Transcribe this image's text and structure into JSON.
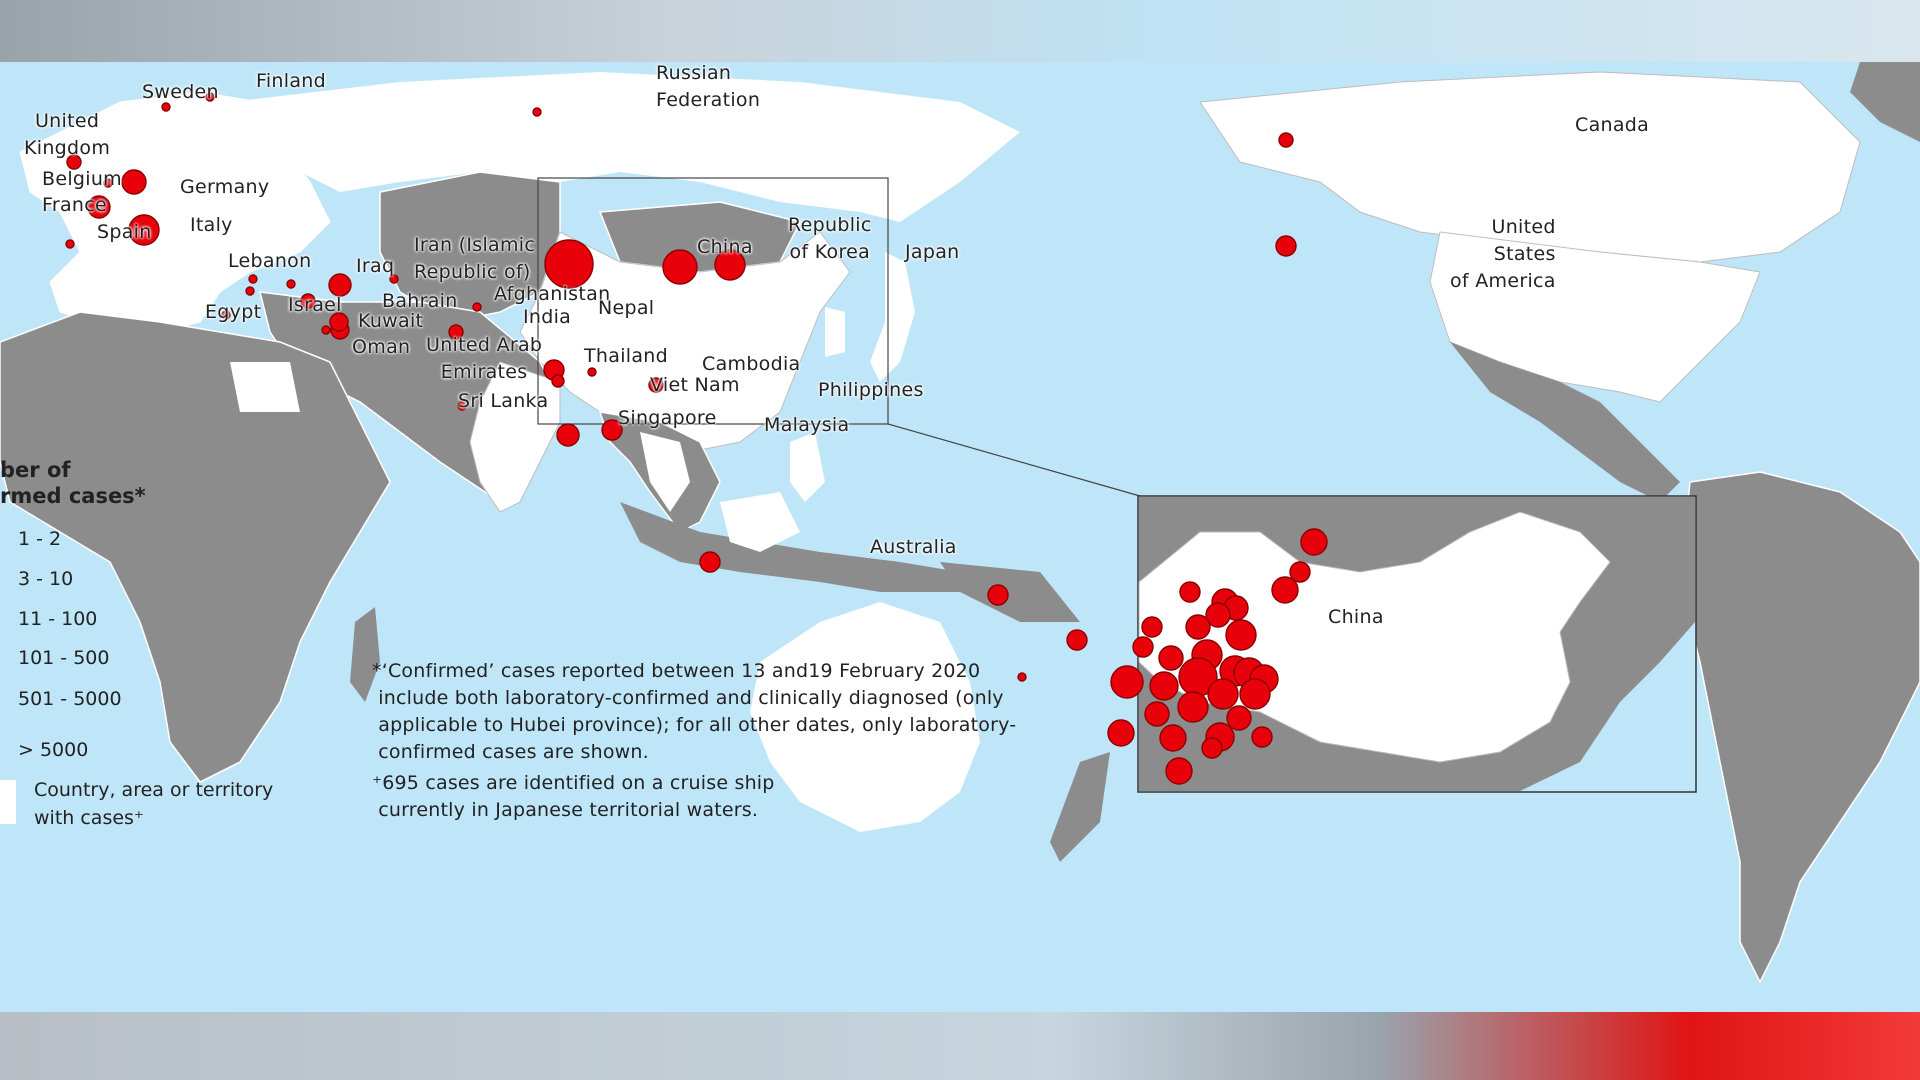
{
  "colors": {
    "ocean": "#bfe6f8",
    "land_no_cases": "#8c8c8c",
    "land_with_cases": "#ffffff",
    "case_marker": "#e8000b"
  },
  "countries": [
    {
      "id": "sweden",
      "label": "Sweden"
    },
    {
      "id": "finland",
      "label": "Finland"
    },
    {
      "id": "russia",
      "label": "Russian\nFederation"
    },
    {
      "id": "uk",
      "label": "United\nKingdom"
    },
    {
      "id": "belgium",
      "label": "Belgium"
    },
    {
      "id": "germany",
      "label": "Germany"
    },
    {
      "id": "france",
      "label": "France"
    },
    {
      "id": "spain",
      "label": "Spain"
    },
    {
      "id": "italy",
      "label": "Italy"
    },
    {
      "id": "lebanon",
      "label": "Lebanon"
    },
    {
      "id": "iraq",
      "label": "Iraq"
    },
    {
      "id": "iran",
      "label": "Iran (Islamic\nRepublic of)"
    },
    {
      "id": "afghanistan",
      "label": "Afghanistan"
    },
    {
      "id": "bahrain",
      "label": "Bahrain"
    },
    {
      "id": "israel",
      "label": "Israel"
    },
    {
      "id": "egypt",
      "label": "Egypt"
    },
    {
      "id": "kuwait",
      "label": "Kuwait"
    },
    {
      "id": "oman",
      "label": "Oman"
    },
    {
      "id": "uae",
      "label": "United Arab\nEmirates"
    },
    {
      "id": "india",
      "label": "India"
    },
    {
      "id": "nepal",
      "label": "Nepal"
    },
    {
      "id": "sri_lanka",
      "label": "Sri Lanka"
    },
    {
      "id": "china",
      "label": "China"
    },
    {
      "id": "korea",
      "label": "Republic\nof Korea"
    },
    {
      "id": "japan",
      "label": "Japan"
    },
    {
      "id": "thailand",
      "label": "Thailand"
    },
    {
      "id": "cambodia",
      "label": "Cambodia"
    },
    {
      "id": "viet_nam",
      "label": "Viet Nam"
    },
    {
      "id": "philippines",
      "label": "Philippines"
    },
    {
      "id": "singapore",
      "label": "Singapore"
    },
    {
      "id": "malaysia",
      "label": "Malaysia"
    },
    {
      "id": "australia",
      "label": "Australia"
    },
    {
      "id": "canada",
      "label": "Canada"
    },
    {
      "id": "usa",
      "label": "United\nStates\nof America"
    }
  ],
  "inset": {
    "label": "China"
  },
  "legend": {
    "title_line1": "ber of",
    "title_line2": "rmed cases*",
    "items": [
      "1 - 2",
      "3 - 10",
      "11 - 100",
      "101 - 500",
      "501 - 5000",
      "> 5000"
    ],
    "swatch_label": "Country, area or territory\nwith cases⁺"
  },
  "footnotes": {
    "note1": "*‘Confirmed’ cases reported between 13 and19 February 2020\n include both laboratory-confirmed and clinically diagnosed (only\n applicable to Hubei province); for all other dates, only laboratory-\n confirmed cases are shown.",
    "note2": "⁺695 cases are identified on a cruise ship\n currently in Japanese territorial waters."
  }
}
